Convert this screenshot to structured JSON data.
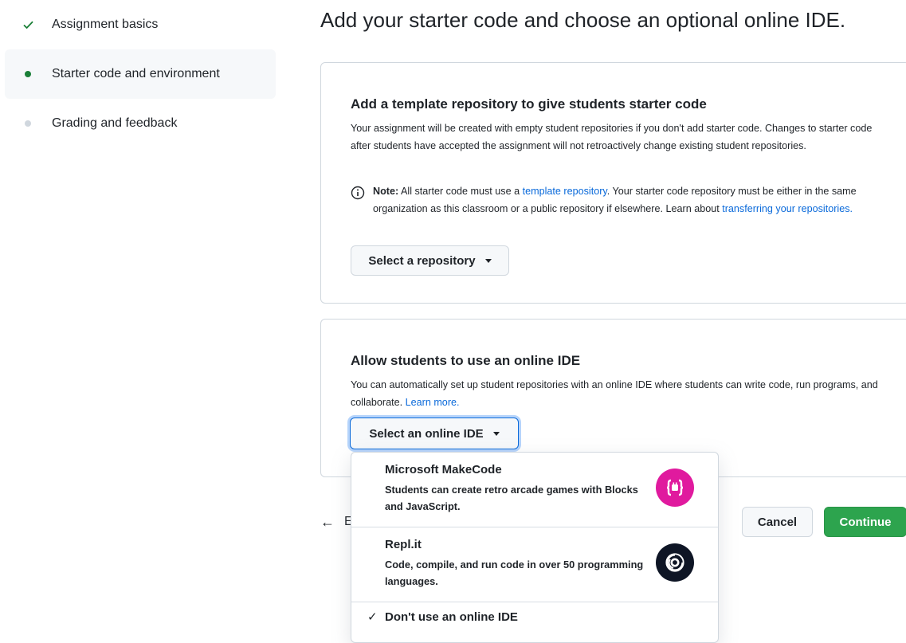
{
  "sidebar": {
    "steps": [
      {
        "label": "Assignment basics",
        "state": "complete"
      },
      {
        "label": "Starter code and environment",
        "state": "active"
      },
      {
        "label": "Grading and feedback",
        "state": "pending"
      }
    ]
  },
  "page": {
    "title": "Add your starter code and choose an optional online IDE."
  },
  "template_section": {
    "heading": "Add a template repository to give students starter code",
    "description": "Your assignment will be created with empty student repositories if you don't add starter code. Changes to starter code after students have accepted the assignment will not retroactively change existing student repositories.",
    "note_label": "Note:",
    "note_text_1": " All starter code must use a ",
    "note_link_1": "template repository",
    "note_text_2": ". Your starter code repository must be either in the same organization as this classroom or a public repository if elsewhere. Learn about ",
    "note_link_2": "transferring your repositories.",
    "select_button": "Select a repository"
  },
  "ide_section": {
    "heading": "Allow students to use an online IDE",
    "description": "You can automatically set up student repositories with an online IDE where students can write code, run programs, and collaborate. ",
    "learn_more": "Learn more.",
    "select_button": "Select an online IDE"
  },
  "dropdown": {
    "options": [
      {
        "title": "Microsoft MakeCode",
        "description": "Students can create retro arcade games with Blocks and JavaScript.",
        "icon": "makecode-logo"
      },
      {
        "title": "Repl.it",
        "description": "Code, compile, and run code in over 50 programming languages.",
        "icon": "replit-logo"
      },
      {
        "title": "Don't use an online IDE",
        "selected": true
      }
    ]
  },
  "footer": {
    "back_partial": "E",
    "cancel": "Cancel",
    "continue": "Continue"
  },
  "colors": {
    "accent_green": "#2da44e",
    "link_blue": "#0969da",
    "makecode_pink": "#e01a9e",
    "replit_dark": "#0e1525"
  }
}
